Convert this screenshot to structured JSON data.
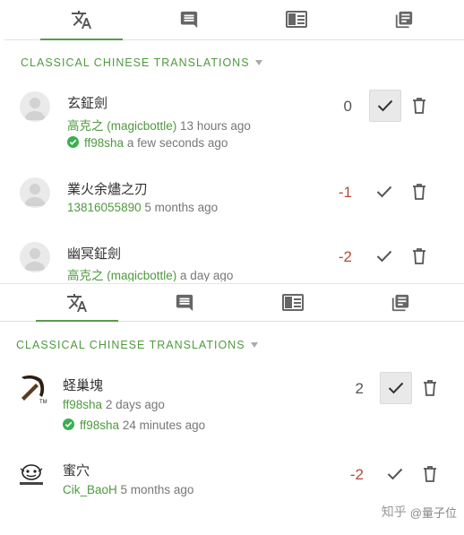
{
  "colors": {
    "accent": "#4e9a3e",
    "negative": "#b24a3a",
    "approved": "#3caf50"
  },
  "tabs": [
    {
      "icon": "translate-icon",
      "active": true
    },
    {
      "icon": "comment-icon"
    },
    {
      "icon": "glossary-icon"
    },
    {
      "icon": "copy-icon"
    }
  ],
  "panel1": {
    "section_title": "CLASSICAL CHINESE TRANSLATIONS",
    "items": [
      {
        "text": "玄鉦劍",
        "author": "高克之 (magicbottle)",
        "time": "13 hours ago",
        "approver": "ff98sha",
        "approved_time": "a few seconds ago",
        "score": "0",
        "approved": true
      },
      {
        "text": "業火余燼之刃",
        "author": "13816055890",
        "time": "5 months ago",
        "score": "-1"
      },
      {
        "text": "幽冥鉦劍",
        "author": "高克之 (magicbottle)",
        "time": "a day ago",
        "score": "-2"
      }
    ]
  },
  "panel2": {
    "section_title": "CLASSICAL CHINESE TRANSLATIONS",
    "items": [
      {
        "text": "蛏巢塊",
        "author": "ff98sha",
        "time": "2 days ago",
        "approver": "ff98sha",
        "approved_time": "24 minutes ago",
        "score": "2",
        "approved": true
      },
      {
        "text": "蜜穴",
        "author": "Cik_BaoH",
        "time": "5 months ago",
        "score": "-2"
      }
    ]
  },
  "watermark": {
    "text": "知乎",
    "handle": "@量子位"
  }
}
